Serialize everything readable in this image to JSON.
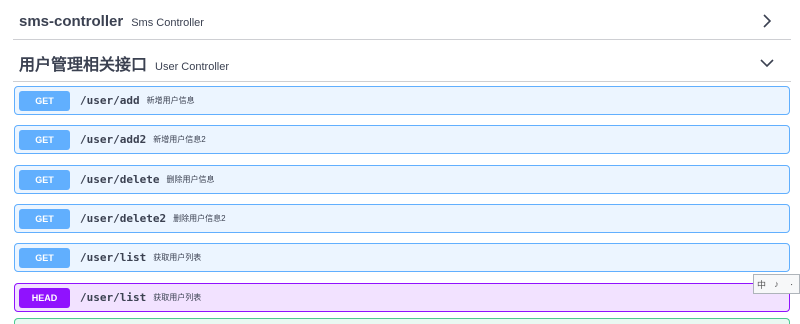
{
  "sections": [
    {
      "title": "sms-controller",
      "description": "Sms Controller",
      "expanded": false
    },
    {
      "title": "用户管理相关接口",
      "description": "User Controller",
      "expanded": true
    }
  ],
  "operations": [
    {
      "method": "GET",
      "path": "/user/add",
      "summary": "新增用户信息"
    },
    {
      "method": "GET",
      "path": "/user/add2",
      "summary": "新增用户信息2"
    },
    {
      "method": "GET",
      "path": "/user/delete",
      "summary": "删除用户信息"
    },
    {
      "method": "GET",
      "path": "/user/delete2",
      "summary": "删除用户信息2"
    },
    {
      "method": "GET",
      "path": "/user/list",
      "summary": "获取用户列表"
    },
    {
      "method": "HEAD",
      "path": "/user/list",
      "summary": "获取用户列表"
    }
  ],
  "ime_toolbar": {
    "mode": "中",
    "punct": "♪",
    "layout": "ㆍ"
  },
  "colors": {
    "get": "#61affe",
    "head": "#9012fe",
    "post": "#49cc90"
  }
}
